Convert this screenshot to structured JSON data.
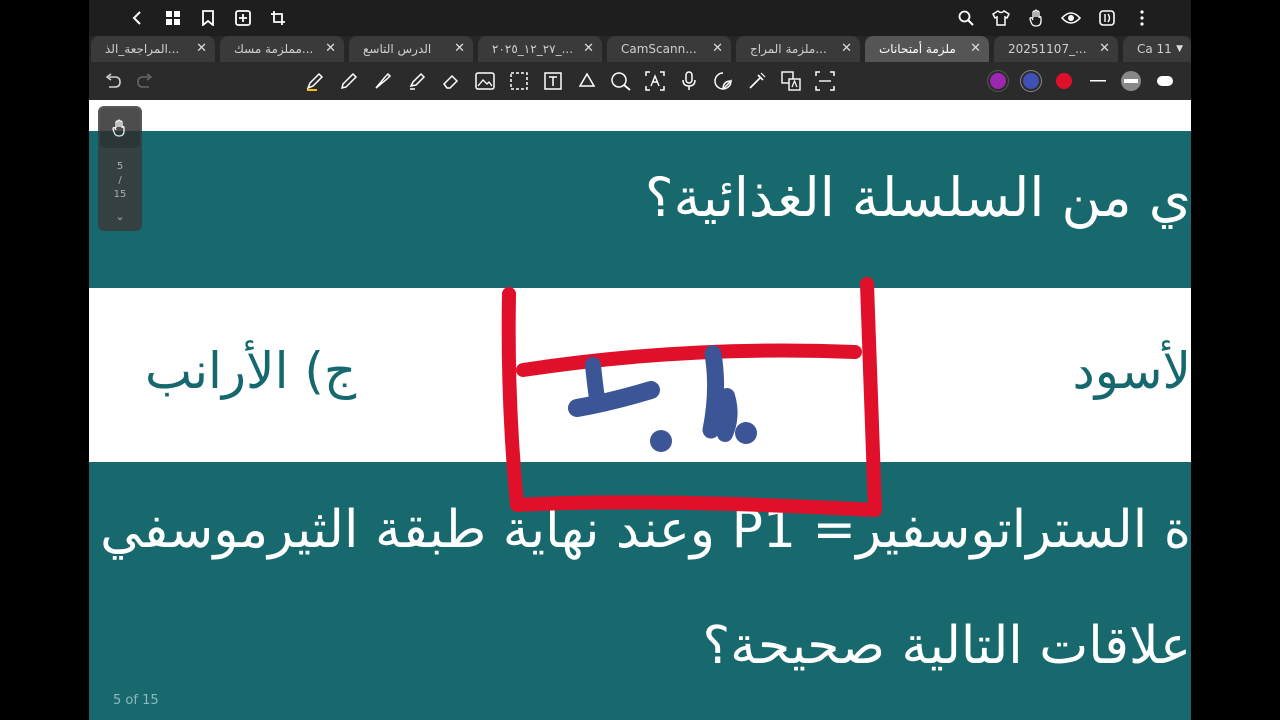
{
  "topbar": {
    "left_icons": [
      "back-icon",
      "grid-icon",
      "bookmark-icon",
      "add-page-icon",
      "crop-icon"
    ],
    "right_icons": [
      "search-icon",
      "shirt-icon",
      "hand-icon",
      "eye-icon",
      "reader-icon",
      "more-icon"
    ]
  },
  "tabs": [
    {
      "label": "المراجعة_الذ..."
    },
    {
      "label": "مملزمة مسك..."
    },
    {
      "label": "الدرس التاسع"
    },
    {
      "label": "۲۰۲٥_۱۲_۲۷_..."
    },
    {
      "label": "CamScann..."
    },
    {
      "label": "ملزمة المراج..."
    },
    {
      "label": "ملزمة أمتحانات",
      "active": true
    },
    {
      "label": "20251107_..."
    },
    {
      "label": "Ca 11"
    }
  ],
  "toolbar": {
    "tools": [
      "undo-icon",
      "redo-icon",
      "pen-icon",
      "pencil-icon",
      "fountain-pen-icon",
      "highlighter-icon",
      "eraser-icon",
      "image-icon",
      "lasso-icon",
      "text-icon",
      "shape-icon",
      "ocr-search-icon",
      "text-recognition-icon",
      "microphone-icon",
      "sticker-icon",
      "laser-pointer-icon",
      "translate-icon",
      "ocr-icon"
    ],
    "colors": {
      "purple": "#9c27b0",
      "blue": "#3f51b5",
      "red": "#e0102a"
    }
  },
  "document": {
    "question1": "ي من السلسلة الغذائية؟",
    "option_j": "ج) الأرانب",
    "option_a": "لأسود",
    "question2_line1": "ة الستراتوسفير= P1 وعند نهاية طبقة الثيرموسفي",
    "question2_line2": "علاقات التالية صحيحة؟",
    "page_indicator": "5 of 15",
    "side_page": {
      "current": "5",
      "sep": "/",
      "total": "15"
    },
    "teal": "#17696e",
    "ink_red": "#e0102a",
    "ink_blue": "#3c5597"
  }
}
